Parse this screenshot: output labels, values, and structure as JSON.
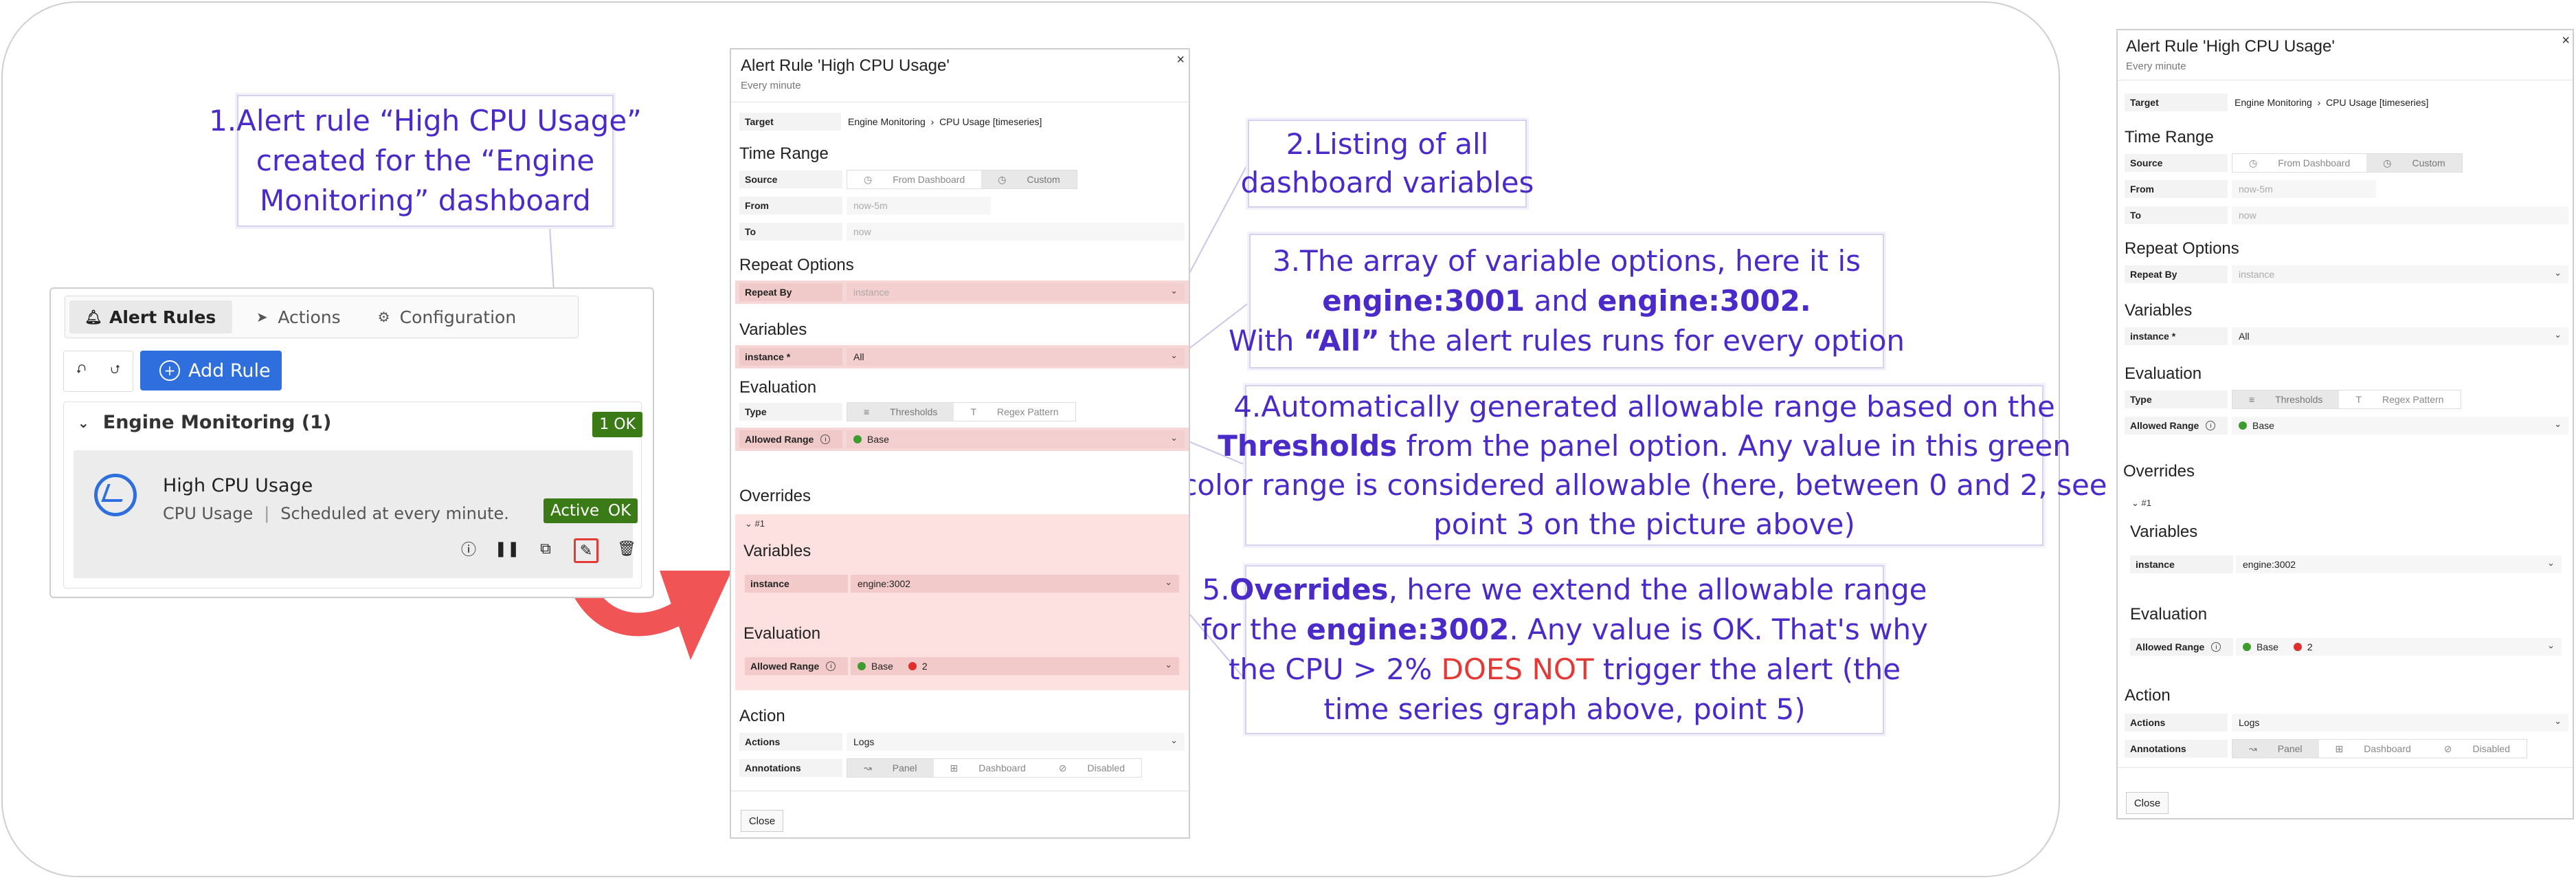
{
  "callouts": {
    "c1": [
      "1.Alert rule “High CPU Usage”",
      "created for the “Engine",
      "Monitoring” dashboard"
    ],
    "c2": [
      "2.Listing of all",
      "dashboard variables"
    ],
    "c3": {
      "l1": "3.The array of variable options, here it is",
      "l2a": "engine:3001",
      "l2b": " and ",
      "l2c": "engine:3002.",
      "l3a": "With ",
      "l3b": "“All”",
      "l3c": " the alert rules runs for every option"
    },
    "c4": {
      "l1": "4.Automatically generated allowable range based on the",
      "l2a": "Thresholds",
      "l2b": " from the panel option. Any value in this green",
      "l3": "color range is considered allowable (here, between 0 and 2, see",
      "l4": "point 3 on the picture above)"
    },
    "c5": {
      "l1a": "5.",
      "l1b": "Overrides",
      "l1c": ", here we extend the allowable range",
      "l2a": "for the ",
      "l2b": "engine:3002",
      "l2c": ". Any value is OK. That's why",
      "l3a": "the CPU > 2% ",
      "l3b": "DOES NOT",
      "l3c": " trigger the alert (the",
      "l4": "time series graph above, point 5)"
    }
  },
  "alert_rules_panel": {
    "tabs": [
      "Alert Rules",
      "Actions",
      "Configuration"
    ],
    "add_rule": "Add Rule",
    "group_title": "Engine Monitoring (1)",
    "group_badge": "1 OK",
    "rule": {
      "name": "High CPU Usage",
      "source": "CPU Usage",
      "schedule": "Scheduled at every minute.",
      "status_active": "Active",
      "status_ok": "OK"
    }
  },
  "editor": {
    "title": "Alert Rule 'High CPU Usage'",
    "subtitle": "Every minute",
    "close_x": "×",
    "target_label": "Target",
    "target_value": "Engine Monitoring  ›  CPU Usage [timeseries]",
    "time_range": "Time Range",
    "source_label": "Source",
    "source_options": [
      "From Dashboard",
      "Custom"
    ],
    "from_label": "From",
    "from_value": "now-5m",
    "to_label": "To",
    "to_value": "now",
    "repeat_options": "Repeat Options",
    "repeat_by_label": "Repeat By",
    "repeat_by_value": "instance",
    "variables": "Variables",
    "instance_label": "instance *",
    "instance_value": "All",
    "evaluation": "Evaluation",
    "type_label": "Type",
    "type_options": [
      "Thresholds",
      "Regex Pattern"
    ],
    "allowed_range_label": "Allowed Range",
    "base_label": "Base",
    "overrides": "Overrides",
    "override_num": "#1",
    "override_instance_label": "instance",
    "override_instance_value": "engine:3002",
    "override_value_2": "2",
    "action": "Action",
    "actions_label": "Actions",
    "actions_value": "Logs",
    "annotations_label": "Annotations",
    "annotation_options": [
      "Panel",
      "Dashboard",
      "Disabled"
    ],
    "close_button": "Close"
  },
  "colors": {
    "callout_text": "#4a2ac9",
    "accent_blue": "#2f6fdd",
    "ok_green": "#3a7a17",
    "highlight_pink": "#f6d7d7",
    "arrow_red": "#f05454"
  }
}
